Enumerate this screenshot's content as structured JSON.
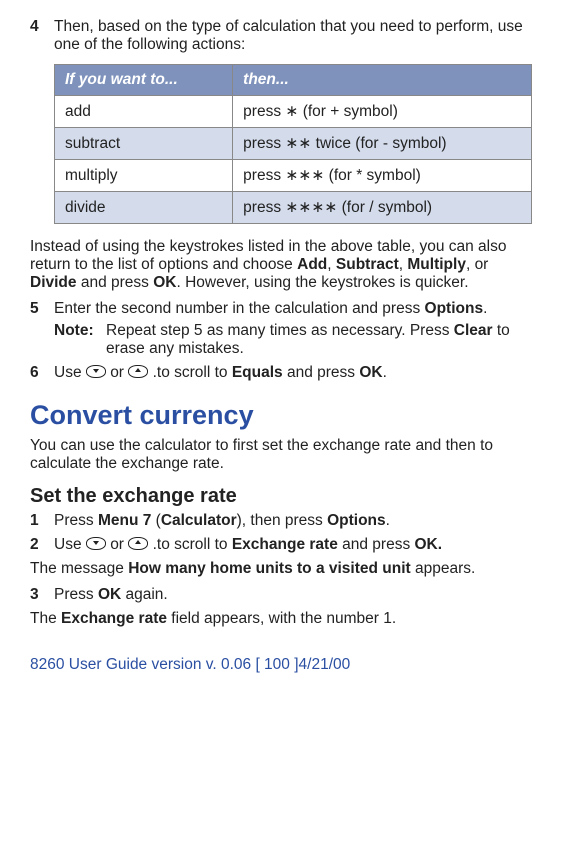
{
  "step4": {
    "num": "4",
    "text_a": "Then, based on the type of calculation that you need to perform, use one of the following actions:"
  },
  "table": {
    "h1": "If you want to...",
    "h2": "then...",
    "rows": [
      {
        "c1": "add",
        "c2a": "press ",
        "c2b": "∗",
        "c2c": " (for + symbol)"
      },
      {
        "c1": "subtract",
        "c2a": "press ",
        "c2b": "∗∗",
        "c2c": " twice (for - symbol)"
      },
      {
        "c1": "multiply",
        "c2a": "press ",
        "c2b": "∗∗∗",
        "c2c": " (for * symbol)"
      },
      {
        "c1": "divide",
        "c2a": "press ",
        "c2b": "∗∗∗∗",
        "c2c": " (for / symbol)"
      }
    ]
  },
  "after_table": {
    "p1a": "Instead of using the keystrokes listed in the above table, you can also return to the list of options and choose ",
    "add": "Add",
    "c1": ", ",
    "sub": "Subtract",
    "c2": ", ",
    "mul": "Multiply",
    "c3": ", or ",
    "div": "Divide",
    "p1b": " and press ",
    "ok": "OK",
    "p1c": ". However, using the keystrokes is quicker."
  },
  "step5": {
    "num": "5",
    "a": "Enter the second number in the calculation and press ",
    "options": "Options",
    "b": ".",
    "note_label": "Note:",
    "note_a": "Repeat step 5 as many times as necessary. Press ",
    "clear": "Clear",
    "note_b": " to erase any mistakes."
  },
  "step6": {
    "num": "6",
    "a": "Use ",
    "b": " or ",
    "c": " .to scroll to ",
    "equals": "Equals",
    "d": " and press ",
    "ok": "OK",
    "e": "."
  },
  "currency": {
    "heading": "Convert currency",
    "intro": "You can use the calculator to first set the exchange rate and then to calculate the exchange rate.",
    "sub": "Set the exchange rate"
  },
  "cur1": {
    "num": "1",
    "a": "Press ",
    "menu": "Menu 7",
    "b": " (",
    "calc": "Calculator",
    "c": "), then press ",
    "options": "Options",
    "d": "."
  },
  "cur2": {
    "num": "2",
    "a": "Use ",
    "b": " or ",
    "c": " .to scroll to ",
    "ex": "Exchange rate",
    "d": " and press ",
    "ok": "OK.",
    "msg_a": "The message ",
    "msg_b": "How many home units to a visited unit",
    "msg_c": " appears."
  },
  "cur3": {
    "num": "3",
    "a": "Press ",
    "ok": "OK",
    "b": " again.",
    "line2_a": "The ",
    "line2_b": "Exchange rate",
    "line2_c": " field appears, with the number 1."
  },
  "footer": "8260 User Guide version v. 0.06 [ 100 ]4/21/00"
}
